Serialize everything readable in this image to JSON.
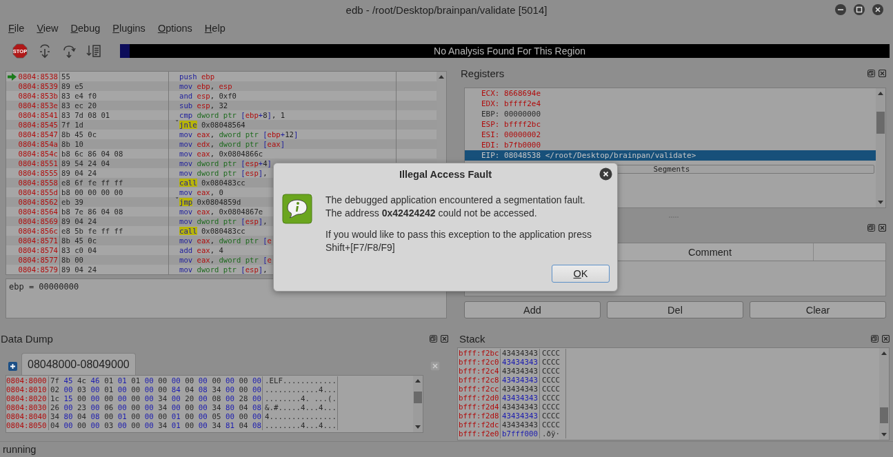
{
  "window": {
    "title": "edb - /root/Desktop/brainpan/validate [5014]"
  },
  "menu": [
    "File",
    "View",
    "Debug",
    "Plugins",
    "Options",
    "Help"
  ],
  "toolbar": {
    "stop_label": "STOP",
    "analysis": "No Analysis Found For This Region"
  },
  "disassembly": {
    "rows": [
      {
        "address": "0804:8538",
        "bytes": "55",
        "current": true,
        "parts": [
          {
            "kind": "op",
            "text": "push "
          },
          {
            "kind": "reg",
            "text": "ebp"
          }
        ]
      },
      {
        "address": "0804:8539",
        "bytes": "89 e5",
        "current": false,
        "parts": [
          {
            "kind": "op",
            "text": "mov "
          },
          {
            "kind": "reg",
            "text": "ebp"
          },
          {
            "kind": "txt",
            "text": ", "
          },
          {
            "kind": "reg",
            "text": "esp"
          }
        ]
      },
      {
        "address": "0804:853b",
        "bytes": "83 e4 f0",
        "current": false,
        "parts": [
          {
            "kind": "op",
            "text": "and "
          },
          {
            "kind": "reg",
            "text": "esp"
          },
          {
            "kind": "txt",
            "text": ", 0xf0"
          }
        ]
      },
      {
        "address": "0804:853e",
        "bytes": "83 ec 20",
        "current": false,
        "parts": [
          {
            "kind": "op",
            "text": "sub "
          },
          {
            "kind": "reg",
            "text": "esp"
          },
          {
            "kind": "txt",
            "text": ", 32"
          }
        ]
      },
      {
        "address": "0804:8541",
        "bytes": "83 7d 08 01",
        "current": false,
        "parts": [
          {
            "kind": "op",
            "text": "cmp "
          },
          {
            "kind": "size",
            "text": "dword ptr "
          },
          {
            "kind": "br",
            "text": "["
          },
          {
            "kind": "reg",
            "text": "ebp"
          },
          {
            "kind": "br",
            "text": "+"
          },
          {
            "kind": "txt",
            "text": "8"
          },
          {
            "kind": "br",
            "text": "]"
          },
          {
            "kind": "txt",
            "text": ", 1"
          }
        ]
      },
      {
        "address": "0804:8545",
        "bytes": "7f 1d",
        "current": false,
        "marker": "ˇ",
        "parts": [
          {
            "kind": "hl",
            "text": "jnle"
          },
          {
            "kind": "txt",
            "text": " 0x08048564"
          }
        ]
      },
      {
        "address": "0804:8547",
        "bytes": "8b 45 0c",
        "current": false,
        "parts": [
          {
            "kind": "op",
            "text": "mov "
          },
          {
            "kind": "reg",
            "text": "eax"
          },
          {
            "kind": "txt",
            "text": ", "
          },
          {
            "kind": "size",
            "text": "dword ptr "
          },
          {
            "kind": "br",
            "text": "["
          },
          {
            "kind": "reg",
            "text": "ebp"
          },
          {
            "kind": "br",
            "text": "+"
          },
          {
            "kind": "txt",
            "text": "12"
          },
          {
            "kind": "br",
            "text": "]"
          }
        ]
      },
      {
        "address": "0804:854a",
        "bytes": "8b 10",
        "current": false,
        "parts": [
          {
            "kind": "op",
            "text": "mov "
          },
          {
            "kind": "reg",
            "text": "edx"
          },
          {
            "kind": "txt",
            "text": ", "
          },
          {
            "kind": "size",
            "text": "dword ptr "
          },
          {
            "kind": "br",
            "text": "["
          },
          {
            "kind": "reg",
            "text": "eax"
          },
          {
            "kind": "br",
            "text": "]"
          }
        ]
      },
      {
        "address": "0804:854c",
        "bytes": "b8 6c 86 04 08",
        "current": false,
        "parts": [
          {
            "kind": "op",
            "text": "mov "
          },
          {
            "kind": "reg",
            "text": "eax"
          },
          {
            "kind": "txt",
            "text": ", 0x0804866c"
          }
        ]
      },
      {
        "address": "0804:8551",
        "bytes": "89 54 24 04",
        "current": false,
        "parts": [
          {
            "kind": "op",
            "text": "mov "
          },
          {
            "kind": "size",
            "text": "dword ptr "
          },
          {
            "kind": "br",
            "text": "["
          },
          {
            "kind": "reg",
            "text": "esp"
          },
          {
            "kind": "br",
            "text": "+"
          },
          {
            "kind": "txt",
            "text": "4"
          },
          {
            "kind": "br",
            "text": "]"
          }
        ]
      },
      {
        "address": "0804:8555",
        "bytes": "89 04 24",
        "current": false,
        "parts": [
          {
            "kind": "op",
            "text": "mov "
          },
          {
            "kind": "size",
            "text": "dword ptr "
          },
          {
            "kind": "br",
            "text": "["
          },
          {
            "kind": "reg",
            "text": "esp"
          },
          {
            "kind": "br",
            "text": "]"
          },
          {
            "kind": "txt",
            "text": ","
          }
        ]
      },
      {
        "address": "0804:8558",
        "bytes": "e8 6f fe ff ff",
        "current": false,
        "parts": [
          {
            "kind": "hl",
            "text": "call"
          },
          {
            "kind": "txt",
            "text": " 0x080483cc"
          }
        ]
      },
      {
        "address": "0804:855d",
        "bytes": "b8 00 00 00 00",
        "current": false,
        "parts": [
          {
            "kind": "op",
            "text": "mov "
          },
          {
            "kind": "reg",
            "text": "eax"
          },
          {
            "kind": "txt",
            "text": ", 0"
          }
        ]
      },
      {
        "address": "0804:8562",
        "bytes": "eb 39",
        "current": false,
        "marker": "ˇ",
        "parts": [
          {
            "kind": "hl",
            "text": "jmp"
          },
          {
            "kind": "txt",
            "text": " 0x0804859d"
          }
        ]
      },
      {
        "address": "0804:8564",
        "bytes": "b8 7e 86 04 08",
        "current": false,
        "parts": [
          {
            "kind": "op",
            "text": "mov "
          },
          {
            "kind": "reg",
            "text": "eax"
          },
          {
            "kind": "txt",
            "text": ", 0x0804867e"
          }
        ]
      },
      {
        "address": "0804:8569",
        "bytes": "89 04 24",
        "current": false,
        "parts": [
          {
            "kind": "op",
            "text": "mov "
          },
          {
            "kind": "size",
            "text": "dword ptr "
          },
          {
            "kind": "br",
            "text": "["
          },
          {
            "kind": "reg",
            "text": "esp"
          },
          {
            "kind": "br",
            "text": "]"
          },
          {
            "kind": "txt",
            "text": ","
          }
        ]
      },
      {
        "address": "0804:856c",
        "bytes": "e8 5b fe ff ff",
        "current": false,
        "parts": [
          {
            "kind": "hl",
            "text": "call"
          },
          {
            "kind": "txt",
            "text": " 0x080483cc"
          }
        ]
      },
      {
        "address": "0804:8571",
        "bytes": "8b 45 0c",
        "current": false,
        "parts": [
          {
            "kind": "op",
            "text": "mov "
          },
          {
            "kind": "reg",
            "text": "eax"
          },
          {
            "kind": "txt",
            "text": ", "
          },
          {
            "kind": "size",
            "text": "dword ptr "
          },
          {
            "kind": "br",
            "text": "["
          },
          {
            "kind": "reg",
            "text": "e"
          }
        ]
      },
      {
        "address": "0804:8574",
        "bytes": "83 c0 04",
        "current": false,
        "parts": [
          {
            "kind": "op",
            "text": "add "
          },
          {
            "kind": "reg",
            "text": "eax"
          },
          {
            "kind": "txt",
            "text": ", 4"
          }
        ]
      },
      {
        "address": "0804:8577",
        "bytes": "8b 00",
        "current": false,
        "parts": [
          {
            "kind": "op",
            "text": "mov "
          },
          {
            "kind": "reg",
            "text": "eax"
          },
          {
            "kind": "txt",
            "text": ", "
          },
          {
            "kind": "size",
            "text": "dword ptr "
          },
          {
            "kind": "br",
            "text": "["
          },
          {
            "kind": "reg",
            "text": "e"
          }
        ]
      },
      {
        "address": "0804:8579",
        "bytes": "89 04 24",
        "current": false,
        "parts": [
          {
            "kind": "op",
            "text": "mov "
          },
          {
            "kind": "size",
            "text": "dword ptr "
          },
          {
            "kind": "br",
            "text": "["
          },
          {
            "kind": "reg",
            "text": "esp"
          },
          {
            "kind": "br",
            "text": "]"
          },
          {
            "kind": "txt",
            "text": ","
          }
        ]
      }
    ],
    "info": "ebp = 00000000"
  },
  "registers": {
    "title": "Registers",
    "rows": [
      {
        "text": "ECX: 8668694e",
        "changed": true,
        "selected": false
      },
      {
        "text": "EDX: bffff2e4",
        "changed": true,
        "selected": false
      },
      {
        "text": "EBP: 00000000",
        "changed": false,
        "selected": false
      },
      {
        "text": "ESP: bffff2bc",
        "changed": true,
        "selected": false
      },
      {
        "text": "ESI: 00000002",
        "changed": true,
        "selected": false
      },
      {
        "text": "EDI: b7fb0000",
        "changed": true,
        "selected": false
      },
      {
        "text": "EIP: 08048538 </root/Desktop/brainpan/validate>",
        "changed": false,
        "selected": true
      }
    ],
    "segments_button": "Segments"
  },
  "bookmarks": {
    "column": "Comment",
    "buttons": [
      "Add",
      "Del",
      "Clear"
    ]
  },
  "data_dump": {
    "title": "Data Dump",
    "tabs": [
      {
        "label": "08048000-08049000",
        "selected": true
      }
    ],
    "rows": [
      {
        "address": "0804:8000",
        "bytes": "7f 45 4c 46 01 01 01 00 00 00 00 00 00 00 00 00",
        "ascii": ".ELF............"
      },
      {
        "address": "0804:8010",
        "bytes": "02 00 03 00 01 00 00 00 00 84 04 08 34 00 00 00",
        "ascii": "............4..."
      },
      {
        "address": "0804:8020",
        "bytes": "1c 15 00 00 00 00 00 00 34 00 20 00 08 00 28 00",
        "ascii": "........4. ...(."
      },
      {
        "address": "0804:8030",
        "bytes": "26 00 23 00 06 00 00 00 34 00 00 00 34 80 04 08",
        "ascii": "&.#.....4...4..."
      },
      {
        "address": "0804:8040",
        "bytes": "34 80 04 08 00 01 00 00 00 01 00 00 05 00 00 00",
        "ascii": "4..............."
      },
      {
        "address": "0804:8050",
        "bytes": "04 00 00 00 03 00 00 00 34 01 00 00 34 81 04 08",
        "ascii": "........4...4..."
      }
    ]
  },
  "stack": {
    "title": "Stack",
    "rows": [
      {
        "address": "bfff:f2bc",
        "value": "43434343",
        "ascii": "CCCC"
      },
      {
        "address": "bfff:f2c0",
        "value": "43434343",
        "ascii": "CCCC"
      },
      {
        "address": "bfff:f2c4",
        "value": "43434343",
        "ascii": "CCCC"
      },
      {
        "address": "bfff:f2c8",
        "value": "43434343",
        "ascii": "CCCC"
      },
      {
        "address": "bfff:f2cc",
        "value": "43434343",
        "ascii": "CCCC"
      },
      {
        "address": "bfff:f2d0",
        "value": "43434343",
        "ascii": "CCCC"
      },
      {
        "address": "bfff:f2d4",
        "value": "43434343",
        "ascii": "CCCC"
      },
      {
        "address": "bfff:f2d8",
        "value": "43434343",
        "ascii": "CCCC"
      },
      {
        "address": "bfff:f2dc",
        "value": "43434343",
        "ascii": "CCCC"
      },
      {
        "address": "bfff:f2e0",
        "value": "b7fff000",
        "ascii": ".ðÿ·"
      }
    ]
  },
  "status_bar": "running",
  "dialog": {
    "title": "Illegal Access Fault",
    "lines": [
      "The debugged application encountered a segmentation fault.",
      "The address **0x42424242** could not be accessed."
    ],
    "hint": "If you would like to pass this exception to the application press Shift+[F7/F8/F9]",
    "button": "OK"
  }
}
